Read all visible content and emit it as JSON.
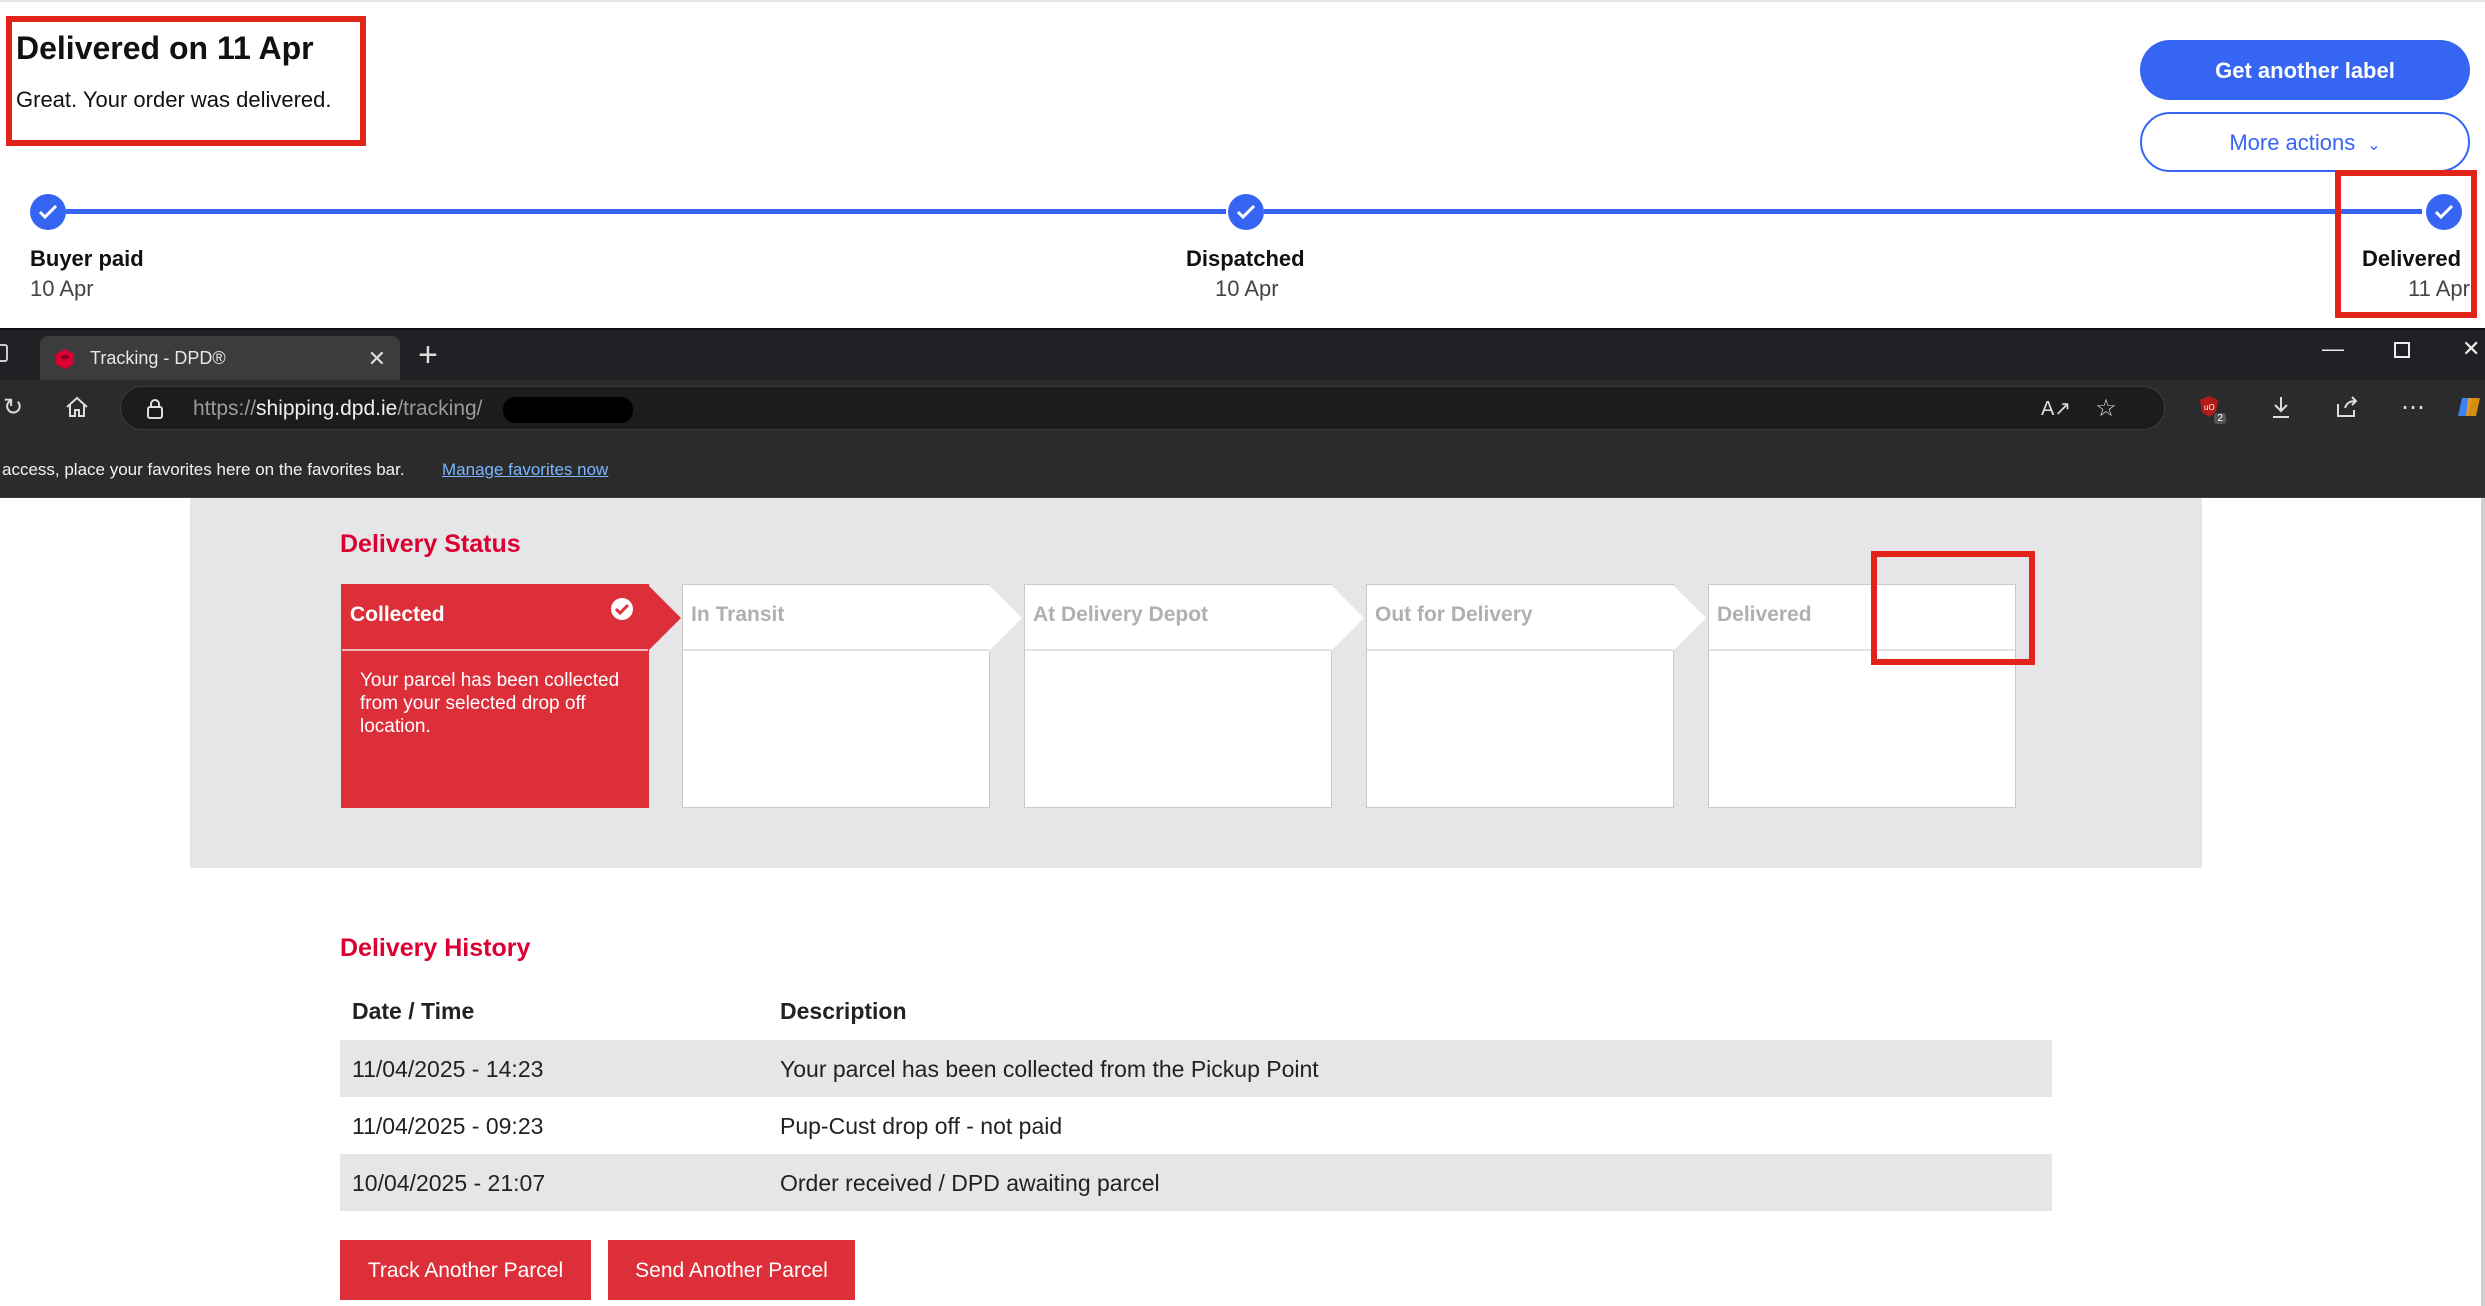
{
  "order": {
    "headline": "Delivered on 11 Apr",
    "subline": "Great. Your order was delivered.",
    "primary_button": "Get another label",
    "secondary_button": "More actions",
    "steps": [
      {
        "label": "Buyer paid",
        "date": "10 Apr"
      },
      {
        "label": "Dispatched",
        "date": "10 Apr"
      },
      {
        "label": "Delivered",
        "date": "11 Apr"
      }
    ],
    "accent_color": "#3665f3",
    "highlight_color": "#e2231a"
  },
  "browser": {
    "tab_title": "Tracking - DPD®",
    "url_prefix": "https://",
    "url_host": "shipping.dpd.ie",
    "url_path": "/tracking/",
    "favorites_text": "access, place your favorites here on the favorites bar.",
    "favorites_link": "Manage favorites now",
    "extension_badge": "2",
    "icons": [
      "refresh-icon",
      "home-icon",
      "lock-icon",
      "read-aloud-icon",
      "favorite-star-icon",
      "extension-icon",
      "download-icon",
      "share-icon",
      "more-icon",
      "copilot-icon"
    ]
  },
  "dpd": {
    "status_title": "Delivery Status",
    "stages": [
      {
        "title": "Collected",
        "desc": "Your parcel has been collected from your selected drop off location.",
        "active": true
      },
      {
        "title": "In Transit",
        "desc": "",
        "active": false
      },
      {
        "title": "At Delivery Depot",
        "desc": "",
        "active": false
      },
      {
        "title": "Out for Delivery",
        "desc": "",
        "active": false
      },
      {
        "title": "Delivered",
        "desc": "",
        "active": false
      }
    ],
    "history_title": "Delivery History",
    "history_headers": {
      "date": "Date / Time",
      "description": "Description"
    },
    "history_rows": [
      {
        "date": "11/04/2025 - 14:23",
        "description": "Your parcel has been collected from the Pickup Point"
      },
      {
        "date": "11/04/2025 - 09:23",
        "description": "Pup-Cust drop off - not paid"
      },
      {
        "date": "10/04/2025 - 21:07",
        "description": "Order received / DPD awaiting parcel"
      }
    ],
    "track_button": "Track Another Parcel",
    "send_button": "Send Another Parcel",
    "brand_red": "#dc0032"
  }
}
